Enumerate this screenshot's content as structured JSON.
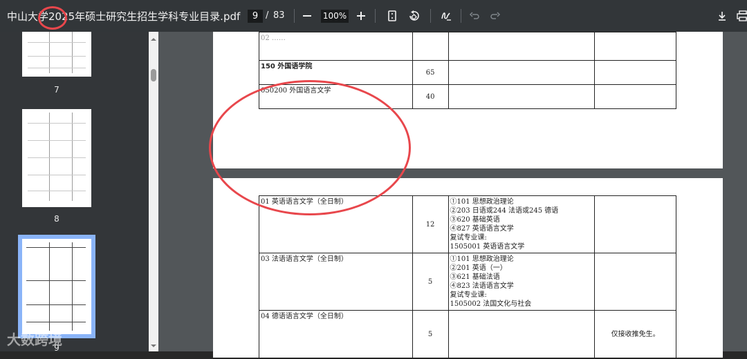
{
  "toolbar": {
    "title": "中山大学2025年硕士研究生招生学科专业目录.pdf",
    "current_page": "9",
    "page_separator": "/",
    "total_pages": "83",
    "zoom": "100%"
  },
  "sidebar": {
    "thumbnails": [
      {
        "number": "7"
      },
      {
        "number": "8"
      },
      {
        "number": "9"
      }
    ]
  },
  "page_top": {
    "rows": [
      {
        "name": "02 ……",
        "count": "",
        "exam": "",
        "note": ""
      },
      {
        "name": "150 外国语学院",
        "count": "65",
        "exam": "",
        "note": ""
      },
      {
        "name": "050200 外国语言文学",
        "count": "40",
        "exam": "",
        "note": ""
      }
    ]
  },
  "page_bottom": {
    "rows": [
      {
        "name": "01 英语语言文学（全日制）",
        "count": "12",
        "exam": [
          "①101 思想政治理论",
          "②203 日语或244 法语或245 德语",
          "③620 基础英语",
          "④827 英语语言文学",
          "复试专业课:",
          "1505001 英语语言文学"
        ],
        "note": ""
      },
      {
        "name": "03 法语语言文学（全日制）",
        "count": "5",
        "exam": [
          "①101 思想政治理论",
          "②201 英语（一）",
          "③621 基础法语",
          "④823 法语语言文学",
          "复试专业课:",
          "1505002 法国文化与社会"
        ],
        "note": ""
      },
      {
        "name": "04 德语语言文学（全日制）",
        "count": "5",
        "exam": [],
        "note": "仅接收推免生。"
      }
    ]
  },
  "watermark": "大数跨境",
  "colors": {
    "annotation": "#e8474c",
    "toolbar": "#323639",
    "viewer_bg": "#525659"
  }
}
